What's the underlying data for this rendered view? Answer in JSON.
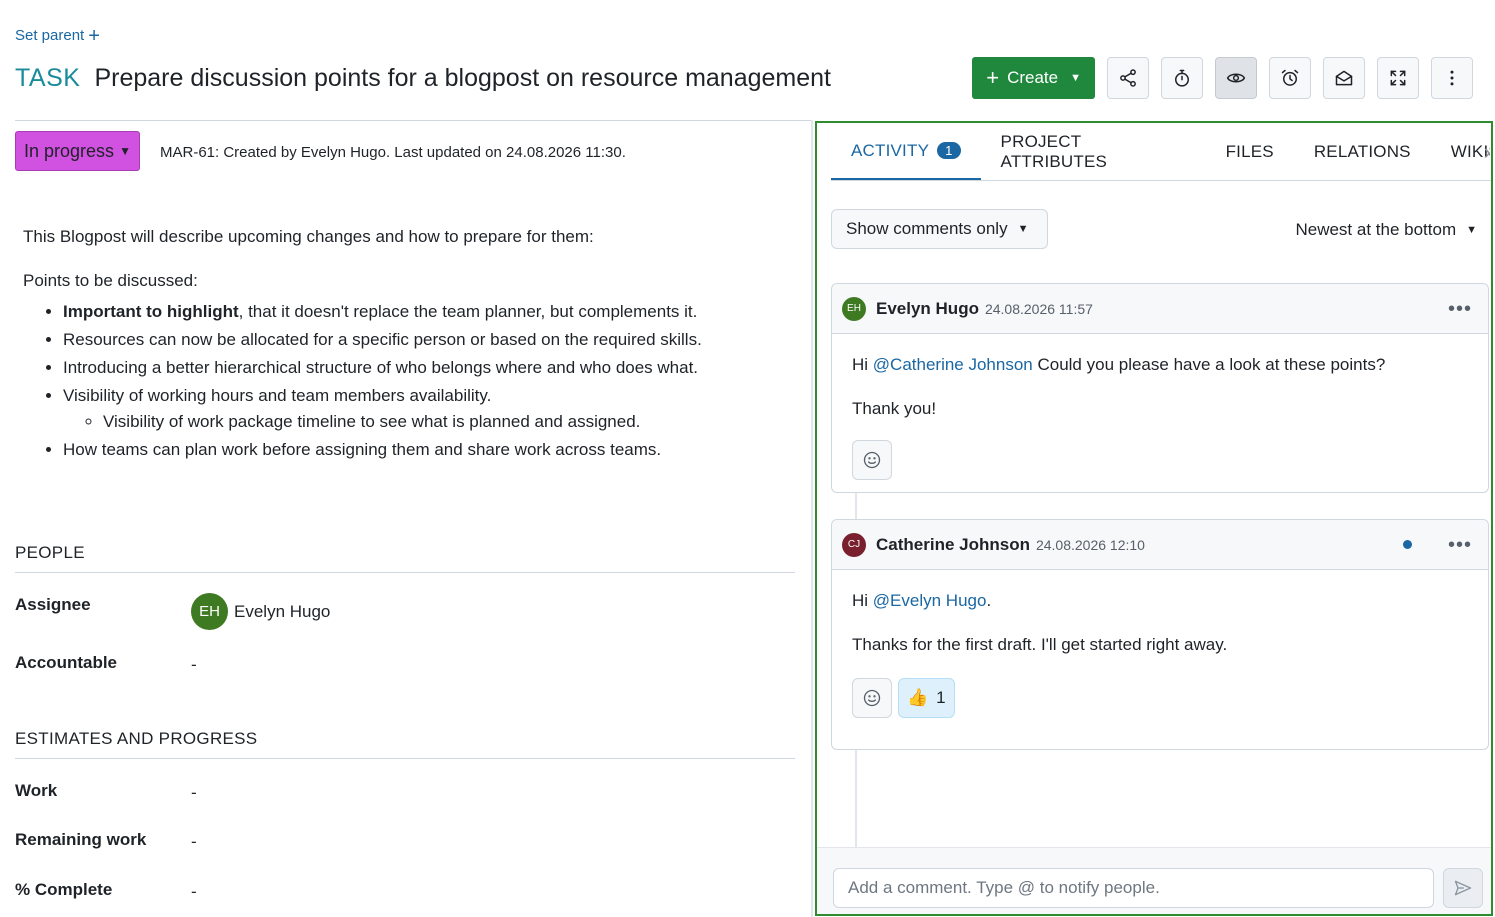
{
  "header": {
    "set_parent_label": "Set parent",
    "type": "TASK",
    "subject": "Prepare discussion points for a blogpost on resource management",
    "create_label": "Create"
  },
  "toolbar_icons": [
    "share-icon",
    "stopwatch-icon",
    "eye-icon",
    "alarm-icon",
    "envelope-open-icon",
    "fullscreen-icon",
    "more-vertical-icon"
  ],
  "status": {
    "label": "In progress",
    "color": "#d151e0"
  },
  "meta": "MAR-61: Created by Evelyn Hugo. Last updated on 24.08.2026 11:30.",
  "description": {
    "intro": "This Blogpost will describe upcoming changes and how to prepare for them:",
    "points_heading": "Points to be discussed:",
    "bullets": [
      {
        "bold": "Important to highlight",
        "text": ", that it doesn't replace the team planner, but complements it."
      },
      {
        "text": "Resources can now be allocated for a specific person or based on the required skills."
      },
      {
        "text": "Introducing a better hierarchical structure of who belongs where and who does what."
      },
      {
        "text": "Visibility of working hours and team members availability."
      },
      {
        "text": "Visibility of work package timeline to see what is planned and assigned."
      },
      {
        "text": "How teams can plan work before assigning them and share work across teams."
      }
    ]
  },
  "people": {
    "title": "PEOPLE",
    "assignee_label": "Assignee",
    "assignee_initials": "EH",
    "assignee_name": "Evelyn Hugo",
    "accountable_label": "Accountable",
    "accountable_value": "-"
  },
  "estimates": {
    "title": "ESTIMATES AND PROGRESS",
    "work_label": "Work",
    "work_value": "-",
    "remaining_label": "Remaining work",
    "remaining_value": "-",
    "complete_label": "% Complete",
    "complete_value": "-"
  },
  "tabs": {
    "activity": "ACTIVITY",
    "activity_count": "1",
    "project_attributes": "PROJECT ATTRIBUTES",
    "files": "FILES",
    "relations": "RELATIONS",
    "wikis": "WIKIS"
  },
  "activity": {
    "filter_label": "Show comments only",
    "sort_label": "Newest at the bottom",
    "comments": [
      {
        "initials": "EH",
        "author": "Evelyn Hugo",
        "time": "24.08.2026 11:57",
        "pre": "Hi ",
        "mention": "@Catherine Johnson",
        "post": " Could you please have a look at these points?",
        "line2": "Thank you!"
      },
      {
        "initials": "CJ",
        "author": "Catherine Johnson",
        "time": "24.08.2026 12:10",
        "pre": "Hi ",
        "mention": "@Evelyn Hugo",
        "post": ".",
        "line2": "Thanks for the first draft. I'll get started right away.",
        "reaction_emoji": "👍",
        "reaction_count": "1"
      }
    ],
    "composer_placeholder": "Add a comment. Type @ to notify people."
  },
  "colors": {
    "primary": "#1a67a3",
    "create_button": "#1f883d",
    "panel_border": "#2e8b2e"
  }
}
